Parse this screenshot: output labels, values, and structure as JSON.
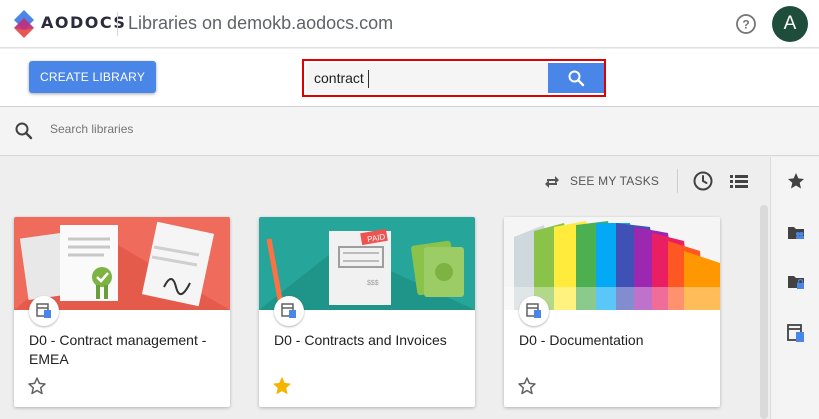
{
  "header": {
    "logo_text": "AODOCS",
    "title": "Libraries on demokb.aodocs.com",
    "avatar_letter": "A",
    "help_icon": "help-circle-icon"
  },
  "actionbar": {
    "create_label": "CREATE LIBRARY",
    "search_value": "contract",
    "search_icon": "search-icon"
  },
  "library_search": {
    "placeholder": "Search libraries"
  },
  "toolbar": {
    "tasks_label": "SEE MY TASKS"
  },
  "cards": [
    {
      "title": "D0 - Contract management - EMEA",
      "starred": false
    },
    {
      "title": "D0 - Contracts and Invoices",
      "starred": true
    },
    {
      "title": "D0 - Documentation",
      "starred": false
    }
  ],
  "colors": {
    "accent": "#4a86e8",
    "highlight": "#e00000",
    "star": "#f4b400",
    "avatar": "#1e4d3c"
  }
}
